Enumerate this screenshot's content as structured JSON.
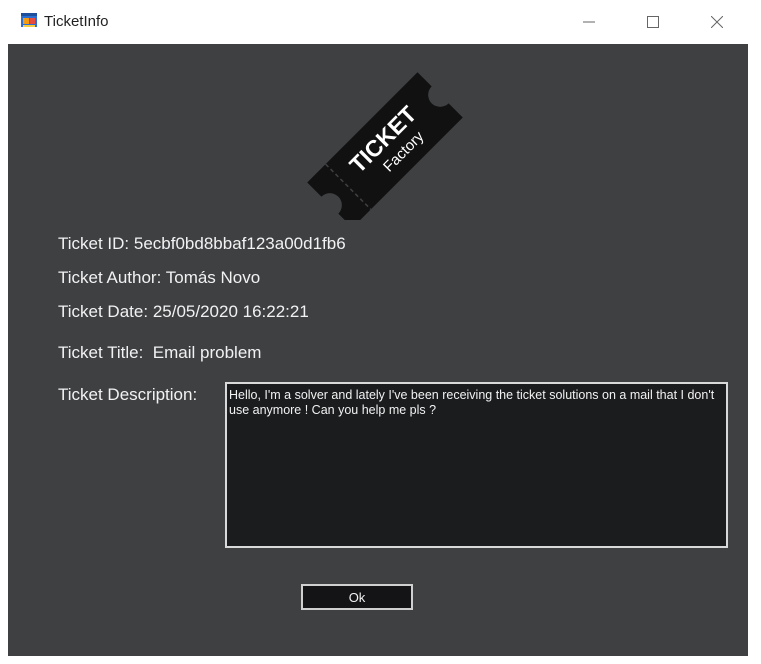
{
  "window": {
    "title": "TicketInfo"
  },
  "icons": {
    "app": "ticketinfo-app-icon",
    "minimize": "minimize-icon",
    "maximize": "maximize-icon",
    "close": "close-icon"
  },
  "logo": {
    "line1": "TICKET",
    "line2": "Factory"
  },
  "ticket": {
    "id_label": "Ticket ID:",
    "id_value": "5ecbf0bd8bbaf123a00d1fb6",
    "author_label": "Ticket Author:",
    "author_value": "Tomás Novo",
    "date_label": "Ticket Date:",
    "date_value": "25/05/2020 16:22:21",
    "title_label": "Ticket Title:",
    "title_value": "Email problem",
    "description_label": "Ticket Description:",
    "description_value": "Hello, I'm a solver and lately I've been receiving the ticket solutions on a mail that I don't use anymore ! Can you help me pls ?"
  },
  "buttons": {
    "ok_label": "Ok"
  },
  "colors": {
    "client_background": "#3f4042",
    "text": "#f2f2f2",
    "textbox_background": "#1b1c1e",
    "border": "#d9d9d9"
  }
}
